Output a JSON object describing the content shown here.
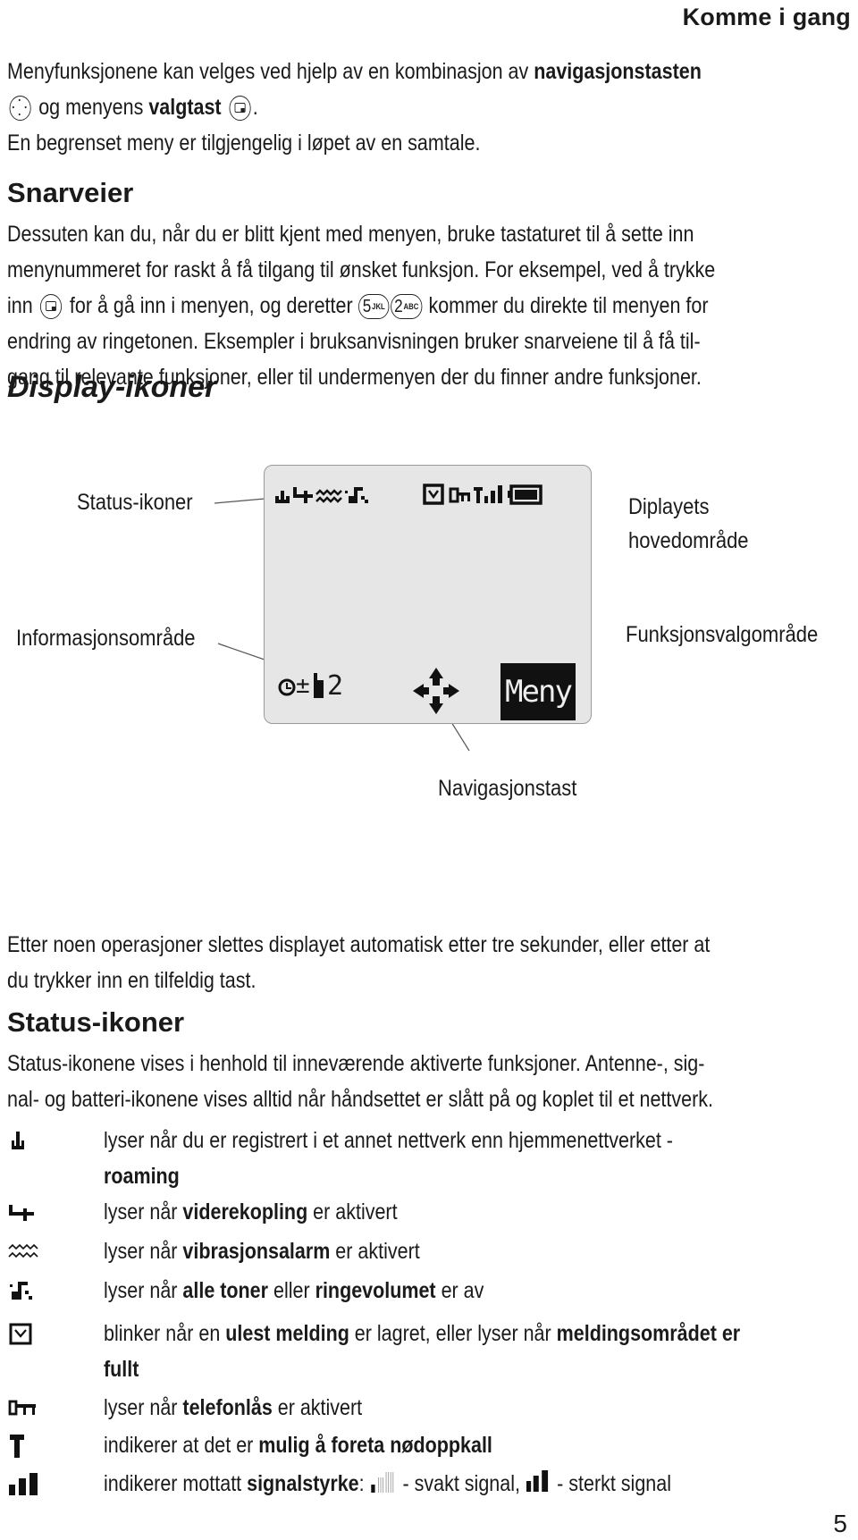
{
  "header": {
    "title": "Komme i gang"
  },
  "intro": {
    "line1_pre": "Menyfunksjonene kan velges ved hjelp av en kombinasjon av ",
    "line1_bold": "navigasjonstasten",
    "line2_pre": " og menyens ",
    "line2_bold": "valgtast",
    "line2_post": ".",
    "line3": "En begrenset meny er tilgjengelig i løpet av en samtale."
  },
  "shortcuts": {
    "heading": "Snarveier",
    "line1": "Dessuten kan du, når du er blitt kjent med menyen, bruke tastaturet til å sette inn",
    "line2": "menynummeret for raskt å få tilgang til ønsket funksjon. For eksempel, ved å trykke",
    "line3_pre": "inn ",
    "line3_mid": " for å gå inn i menyen, og deretter ",
    "line3_post": " kommer du direkte til menyen for",
    "key1_digit": "5",
    "key1_letters": "JKL",
    "key2_digit": "2",
    "key2_letters": "ABC",
    "line4": "endring av ringetonen. Eksempler i bruksanvisningen bruker snarveiene til å få til-",
    "line5": "gang til relevante funksjoner, eller til undermenyen der du finner andre funksjoner."
  },
  "display_icons": {
    "heading": "Display-ikoner",
    "labels": {
      "status": "Status-ikoner",
      "main_line1": "Diplayets",
      "main_line2": "hovedområde",
      "info": "Informasjonsområde",
      "function": "Funksjonsvalgområde",
      "nav": "Navigasjonstast"
    },
    "lcd": {
      "softkey": "Meny",
      "info_text": "±",
      "line_number": "2"
    }
  },
  "after_figure": {
    "line1": "Etter noen operasjoner slettes displayet automatisk etter tre sekunder, eller etter at",
    "line2": "du trykker inn en tilfeldig tast."
  },
  "status_icons": {
    "heading": "Status-ikoner",
    "line1": "Status-ikonene vises i henhold til inneværende aktiverte funksjoner. Antenne-, sig-",
    "line2": "nal- og batteri-ikonene vises alltid når håndsettet er slått på og koplet til et nettverk.",
    "items": [
      {
        "icon": "roaming-icon",
        "pre": "lyser når du er registrert i et annet nettverk enn hjemmenettverket -",
        "bold": "roaming",
        "post": ""
      },
      {
        "icon": "call-divert-icon",
        "pre": "lyser når ",
        "bold": "viderekopling",
        "post": " er aktivert"
      },
      {
        "icon": "vibration-icon",
        "pre": "lyser når ",
        "bold": "vibrasjonsalarm",
        "post": " er aktivert"
      },
      {
        "icon": "silent-icon",
        "pre": "lyser når ",
        "bold": "alle toner",
        "mid": " eller ",
        "bold2": "ringevolumet",
        "post": " er av"
      },
      {
        "icon": "message-icon",
        "pre": "blinker når en ",
        "bold": "ulest melding",
        "mid": " er lagret, eller lyser når ",
        "bold2": "meldingsområdet er",
        "line2": "fullt"
      },
      {
        "icon": "key-lock-icon",
        "pre": "lyser når ",
        "bold": "telefonlås",
        "post": " er aktivert"
      },
      {
        "icon": "antenna-icon",
        "pre": "indikerer at det er ",
        "bold": "mulig å foreta nødoppkall",
        "post": ""
      },
      {
        "icon": "signal-icon",
        "pre": "indikerer mottatt ",
        "bold": "signalstyrke",
        "colon": ":",
        "weak": " - svakt signal, ",
        "strong": " - sterkt signal"
      }
    ]
  },
  "page_number": "5"
}
